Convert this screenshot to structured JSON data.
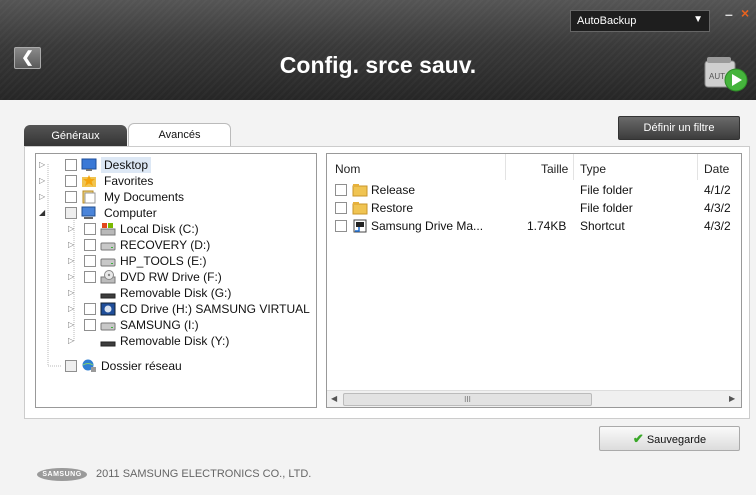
{
  "header": {
    "title": "Config. srce sauv.",
    "back_icon": "chevron-left-icon",
    "profile_select": "AutoBackup",
    "minimize_label": "–",
    "close_label": "×",
    "auto_badge": "AUT"
  },
  "tabs": [
    {
      "label": "Généraux"
    },
    {
      "label": "Avancés"
    }
  ],
  "filter_button": "Définir un filtre",
  "tree": {
    "items": [
      {
        "label": "Desktop",
        "icon": "desktop-icon"
      },
      {
        "label": "Favorites",
        "icon": "star-folder-icon"
      },
      {
        "label": "My Documents",
        "icon": "documents-icon"
      },
      {
        "label": "Computer",
        "icon": "computer-icon"
      },
      {
        "label": "Local Disk (C:)",
        "icon": "local-disk-icon"
      },
      {
        "label": "RECOVERY (D:)",
        "icon": "drive-icon"
      },
      {
        "label": "HP_TOOLS (E:)",
        "icon": "drive-icon"
      },
      {
        "label": "DVD RW Drive (F:)",
        "icon": "dvd-drive-icon"
      },
      {
        "label": "Removable Disk (G:)",
        "icon": "removable-disk-icon"
      },
      {
        "label": "CD Drive (H:) SAMSUNG VIRTUAL",
        "icon": "cd-drive-icon"
      },
      {
        "label": "SAMSUNG (I:)",
        "icon": "drive-icon"
      },
      {
        "label": "Removable Disk (Y:)",
        "icon": "removable-disk-icon"
      },
      {
        "label": "Dossier réseau",
        "icon": "network-icon"
      }
    ]
  },
  "files": {
    "columns": [
      "Nom",
      "Taille",
      "Type",
      "Date"
    ],
    "rows": [
      {
        "name": "Release",
        "size": "",
        "type": "File folder",
        "date": "4/1/2"
      },
      {
        "name": "Restore",
        "size": "",
        "type": "File folder",
        "date": "4/3/2"
      },
      {
        "name": "Samsung Drive Ma...",
        "size": "1.74KB",
        "type": "Shortcut",
        "date": "4/3/2"
      }
    ],
    "scroll_grip": "III"
  },
  "save_button": "Sauvegarde",
  "footer": {
    "logo_text": "SAMSUNG",
    "copyright": "2011 SAMSUNG ELECTRONICS CO., LTD."
  }
}
